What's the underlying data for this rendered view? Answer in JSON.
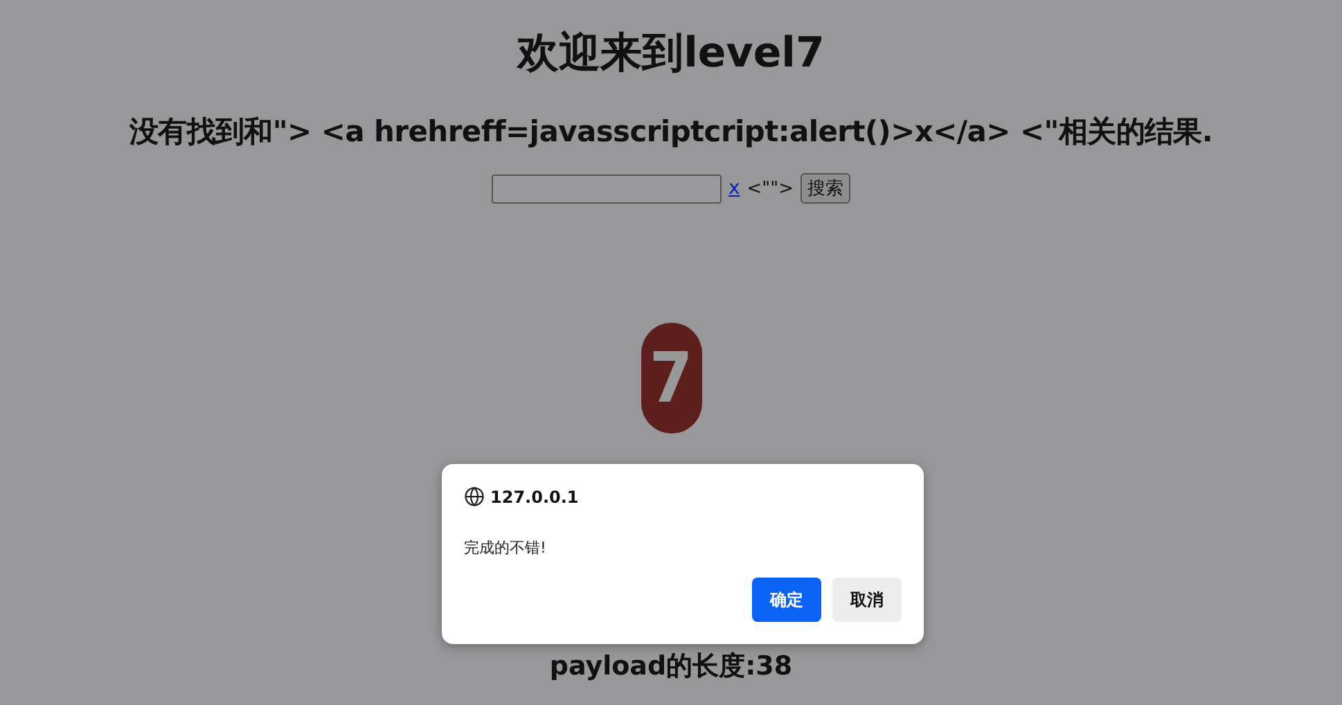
{
  "title": "欢迎来到level7",
  "result_message": "没有找到和\"> <a hrehreff=javasscriptcript:alert()>x</a> <\"相关的结果.",
  "search_form": {
    "link": "x",
    "trailing_text": "<\"\">",
    "button": "搜索"
  },
  "level_badge": "7",
  "payload_length": "payload的长度:38",
  "dialog": {
    "origin": "127.0.0.1",
    "message": "完成的不错!",
    "buttons": [
      {
        "label": "确定",
        "kind": "primary"
      },
      {
        "label": "取消",
        "kind": "secondary"
      }
    ]
  }
}
